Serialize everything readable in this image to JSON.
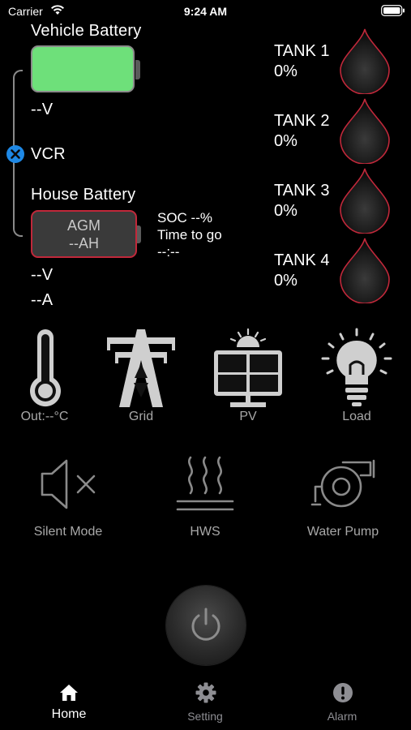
{
  "status_bar": {
    "carrier": "Carrier",
    "time": "9:24 AM"
  },
  "vehicle_battery": {
    "title": "Vehicle Battery",
    "voltage": "--V",
    "level_pct": 100,
    "color": "#6ee07a"
  },
  "vcr": {
    "label": "VCR",
    "accent": "#0a84ff"
  },
  "house_battery": {
    "title": "House Battery",
    "type": "AGM",
    "capacity": "--AH",
    "soc": "SOC --%",
    "time_to_go_label": "Time to go",
    "time_to_go": "--:--",
    "voltage": "--V",
    "current": "--A",
    "border_color": "#c0283a"
  },
  "tanks": [
    {
      "name": "TANK 1",
      "percent": "0%",
      "level": 0
    },
    {
      "name": "TANK 2",
      "percent": "0%",
      "level": 0
    },
    {
      "name": "TANK 3",
      "percent": "0%",
      "level": 0
    },
    {
      "name": "TANK 4",
      "percent": "0%",
      "level": 0
    }
  ],
  "sources": [
    {
      "label": "Out:--°C",
      "icon": "thermometer-icon"
    },
    {
      "label": "Grid",
      "icon": "power-tower-icon"
    },
    {
      "label": "PV",
      "icon": "solar-panel-icon"
    },
    {
      "label": "Load",
      "icon": "light-bulb-icon"
    }
  ],
  "controls": [
    {
      "label": "Silent Mode",
      "icon": "speaker-mute-icon"
    },
    {
      "label": "HWS",
      "icon": "heat-waves-icon"
    },
    {
      "label": "Water Pump",
      "icon": "water-pump-icon"
    }
  ],
  "power_button": {
    "icon": "power-icon"
  },
  "tab_bar": {
    "accent": "#ffffff",
    "inactive": "#8e8e93",
    "tabs": [
      {
        "label": "Home",
        "icon": "home-icon",
        "active": true
      },
      {
        "label": "Setting",
        "icon": "gear-icon",
        "active": false
      },
      {
        "label": "Alarm",
        "icon": "alert-icon",
        "active": false
      }
    ]
  }
}
